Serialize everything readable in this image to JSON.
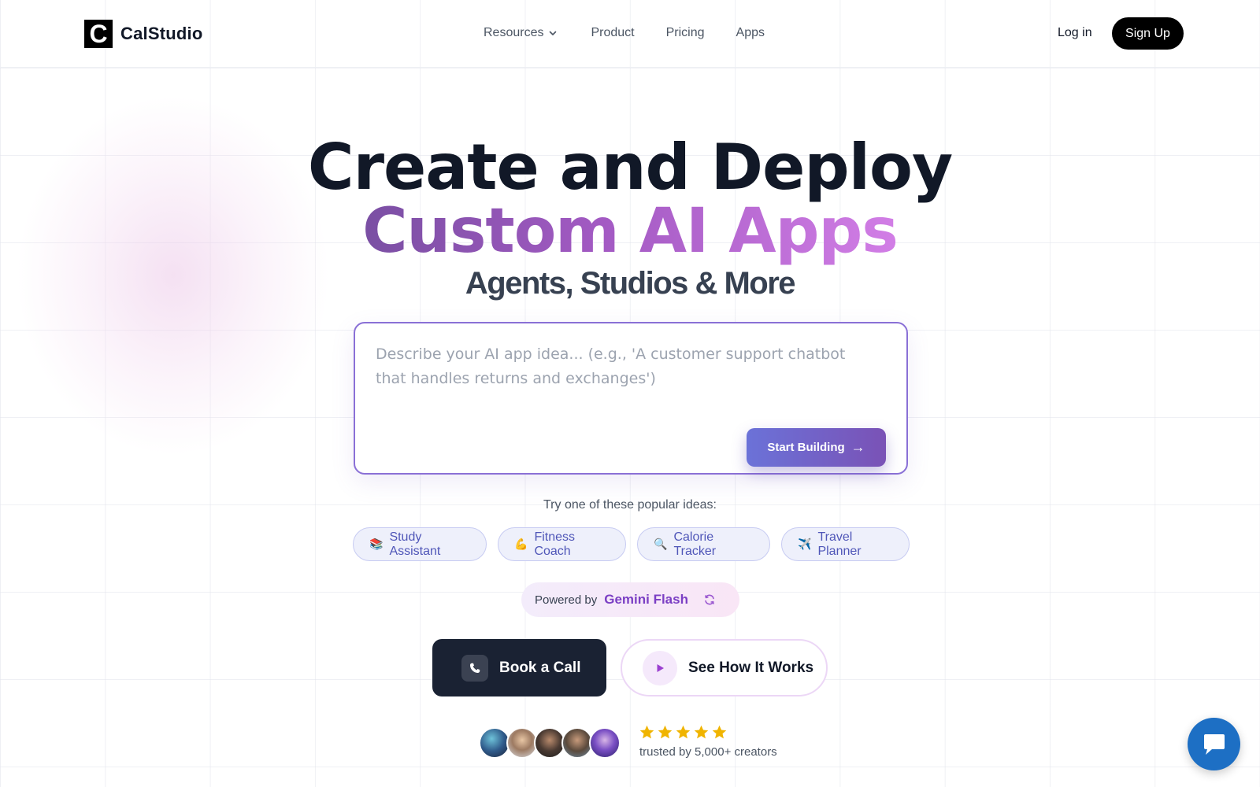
{
  "header": {
    "logo_letter": "C",
    "logo_text": "CalStudio",
    "nav": {
      "resources": "Resources",
      "product": "Product",
      "pricing": "Pricing",
      "apps": "Apps"
    },
    "login": "Log in",
    "signup": "Sign Up"
  },
  "hero": {
    "line1": "Create and Deploy",
    "line2": "Custom AI Apps",
    "line3": "Agents, Studios & More"
  },
  "prompt": {
    "placeholder": "Describe your AI app idea... (e.g., 'A customer support chatbot that handles returns and exchanges')",
    "value": "",
    "button_label": "Start Building",
    "button_arrow": "→"
  },
  "ideas": {
    "title": "Try one of these popular ideas:",
    "items": [
      {
        "emoji": "📚",
        "label": "Study Assistant"
      },
      {
        "emoji": "💪",
        "label": "Fitness Coach"
      },
      {
        "emoji": "🔍",
        "label": "Calorie Tracker"
      },
      {
        "emoji": "✈️",
        "label": "Travel Planner"
      }
    ]
  },
  "powered": {
    "label": "Powered by",
    "model": "Gemini Flash"
  },
  "cta": {
    "book_call": "Book a Call",
    "how_it_works": "See How It Works"
  },
  "social_proof": {
    "rating": 5,
    "trusted_text": "trusted by 5,000+ creators"
  },
  "colors": {
    "accent_purple": "#7b3fc4",
    "chip_text": "#4f56b8",
    "dark_button": "#1a2233",
    "chat_blue": "#1d6fc4",
    "star": "#f0b400"
  },
  "icons": {
    "resources_chevron": "chevron-down-icon",
    "refresh": "refresh-icon",
    "phone": "phone-icon",
    "play": "play-icon",
    "star": "star-icon",
    "chat": "chat-bubble-icon"
  }
}
